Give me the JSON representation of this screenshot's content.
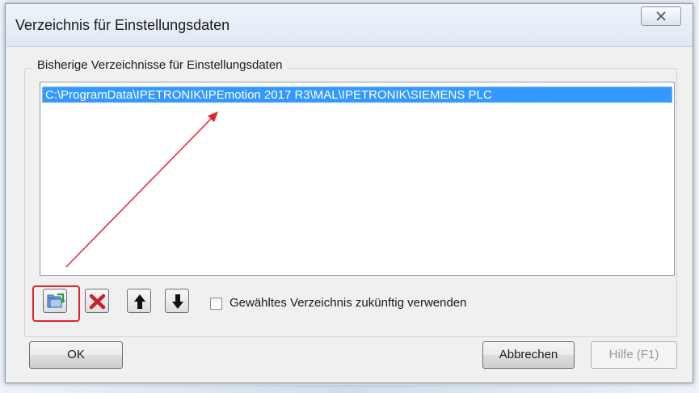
{
  "dialog": {
    "title": "Verzeichnis für Einstellungsdaten",
    "group_label": "Bisherige Verzeichnisse für Einstellungsdaten",
    "list_items": [
      "C:\\ProgramData\\IPETRONIK\\IPEmotion 2017 R3\\MAL\\IPETRONIK\\SIEMENS PLC"
    ],
    "checkbox_label": "Gewähltes Verzeichnis zukünftig verwenden",
    "checkbox_checked": false,
    "buttons": {
      "ok": "OK",
      "cancel": "Abbrechen",
      "help": "Hilfe (F1)"
    },
    "toolbar_icons": [
      "add-folder-icon",
      "delete-icon",
      "move-up-icon",
      "move-down-icon"
    ],
    "colors": {
      "selection": "#3399ff",
      "annotation": "#e0242d"
    }
  }
}
